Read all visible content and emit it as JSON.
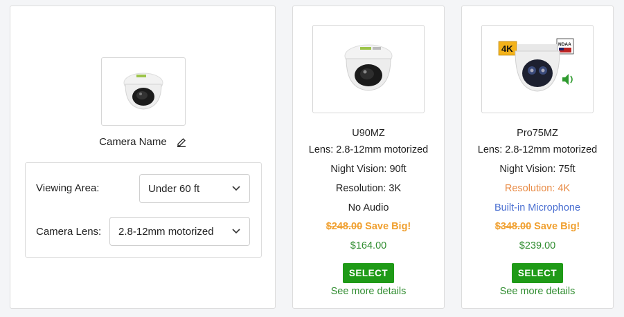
{
  "config": {
    "camera_name": "Camera Name",
    "viewing_area_label": "Viewing Area:",
    "viewing_area_value": "Under 60 ft",
    "camera_lens_label": "Camera Lens:",
    "camera_lens_value": "2.8-12mm motorized"
  },
  "products": [
    {
      "name": "U90MZ",
      "lens": "Lens: 2.8-12mm motorized",
      "night_vision": "Night Vision: 90ft",
      "resolution": "Resolution: 3K",
      "audio": "No Audio",
      "old_price": "$248.00",
      "save_label": "Save Big!",
      "price": "$164.00",
      "select_label": "SELECT",
      "details_label": "See more details"
    },
    {
      "name": "Pro75MZ",
      "lens": "Lens: 2.8-12mm motorized",
      "night_vision": "Night Vision: 75ft",
      "resolution": "Resolution: 4K",
      "audio": "Built-in Microphone",
      "old_price": "$348.00",
      "save_label": "Save Big!",
      "price": "$239.00",
      "select_label": "SELECT",
      "details_label": "See more details",
      "badge_4k": "4K",
      "badge_ndaa": "NDAA"
    }
  ],
  "colors": {
    "green": "#1f9a17",
    "orange": "#f0a030",
    "blue": "#4a6fd1"
  }
}
